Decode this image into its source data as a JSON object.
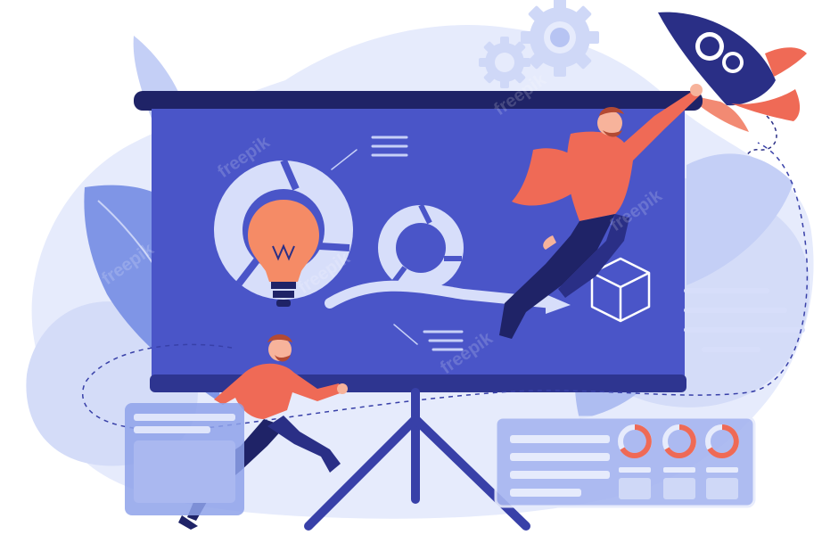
{
  "image": {
    "watermark": "freepik",
    "colors": {
      "background_blob": "#dfe5fb",
      "blob_dark": "#c8d2f6",
      "screen": "#4b55c9",
      "screen_dark": "#2f3594",
      "frame": "#262b78",
      "accent_orange": "#ef6a56",
      "accent_orange_light": "#f7b39b",
      "bulb": "#f58b66",
      "light_lines": "#d7defa",
      "dark_navy": "#1e2160",
      "leaf": "#8aa0ea"
    },
    "icons": [
      "gear-icon",
      "rocket-icon",
      "lightbulb-icon",
      "cycle-arrows-icon",
      "cube-icon",
      "progress-ring-icon"
    ]
  }
}
